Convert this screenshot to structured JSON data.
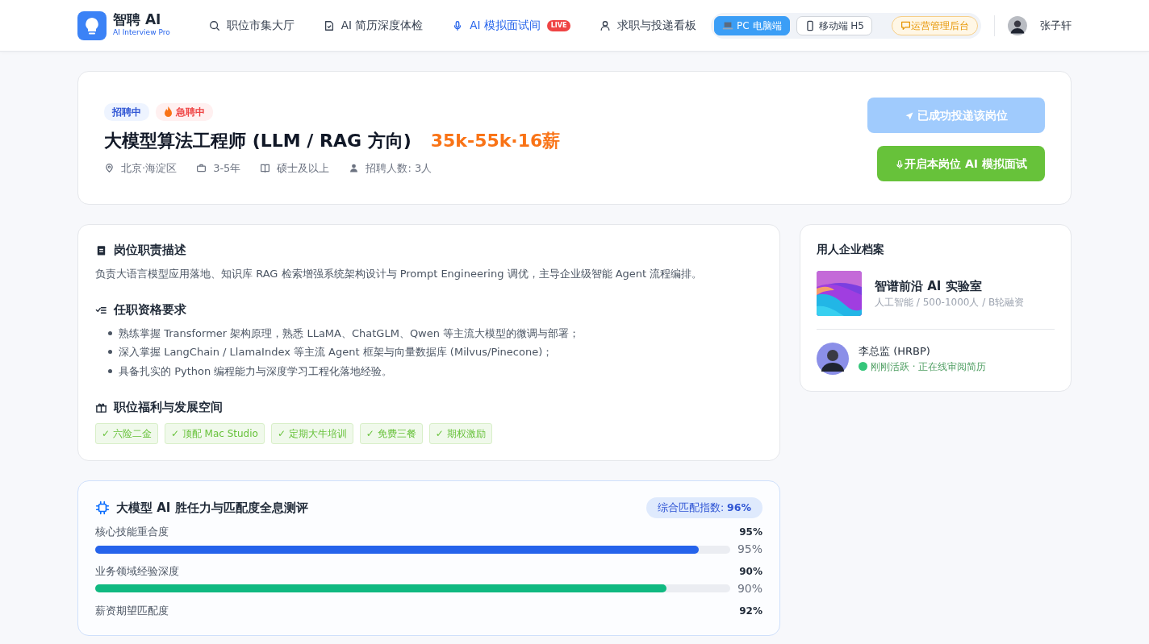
{
  "brand": {
    "name": "智聘 AI",
    "tagline": "AI Interview Pro"
  },
  "nav": [
    {
      "label": "职位市集大厅",
      "selected": false
    },
    {
      "label": "AI 简历深度体检",
      "selected": false
    },
    {
      "label": "AI 模拟面试间",
      "selected": true,
      "badge": "LIVE"
    },
    {
      "label": "求职与投递看板",
      "selected": false
    }
  ],
  "device_switch": [
    {
      "label": "PC 电脑端",
      "selected": true
    },
    {
      "label": "移动端 H5",
      "selected": false
    }
  ],
  "admin_button": "运营管理后台",
  "user": {
    "name": "张子轩"
  },
  "job": {
    "tags": [
      {
        "text": "招聘中",
        "kind": "status"
      },
      {
        "text": "急聘中",
        "kind": "urgent"
      }
    ],
    "title": "大模型算法工程师 (LLM / RAG 方向)",
    "salary": "35k-55k·16薪",
    "meta": [
      "北京·海淀区",
      "3-5年",
      "硕士及以上",
      "招聘人数: 3人"
    ],
    "apply_button": {
      "label": "已成功投递该岗位",
      "disabled": true
    },
    "interview_button": {
      "label": "开启本岗位 AI 模拟面试",
      "disabled": false
    }
  },
  "description": {
    "title": "岗位职责描述",
    "text": "负责大语言模型应用落地、知识库 RAG 检索增强系统架构设计与 Prompt Engineering 调优，主导企业级智能 Agent 流程编排。"
  },
  "requirements": {
    "title": "任职资格要求",
    "items": [
      "熟练掌握 Transformer 架构原理，熟悉 LLaMA、ChatGLM、Qwen 等主流大模型的微调与部署；",
      "深入掌握 LangChain / LlamaIndex 等主流 Agent 框架与向量数据库 (Milvus/Pinecone)；",
      "具备扎实的 Python 编程能力与深度学习工程化落地经验。"
    ]
  },
  "benefits": {
    "title": "职位福利与发展空间",
    "tags": [
      "✓ 六险二金",
      "✓ 顶配 Mac Studio",
      "✓ 定期大牛培训",
      "✓ 免费三餐",
      "✓ 期权激励"
    ]
  },
  "assessment": {
    "title": "大模型 AI 胜任力与匹配度全息测评",
    "score": "综合匹配指数: **96%**",
    "metrics": [
      {
        "name": "核心技能重合度",
        "value": "95%",
        "level": 0.95,
        "reading": "95%",
        "color": "#2563eb"
      },
      {
        "name": "业务领域经验深度",
        "value": "90%",
        "level": 0.9,
        "reading": "90%",
        "color": "#10b981"
      },
      {
        "name": "薪资期望匹配度",
        "value": "92%"
      }
    ]
  },
  "company": {
    "title": "用人企业档案",
    "name": "智谱前沿 AI 实验室",
    "info": "人工智能 / 500-1000人 / B轮融资",
    "recruiter": {
      "name": "李总监 (HRBP)",
      "status": "刚刚活跃 · 正在线审阅简历",
      "online": true
    }
  }
}
